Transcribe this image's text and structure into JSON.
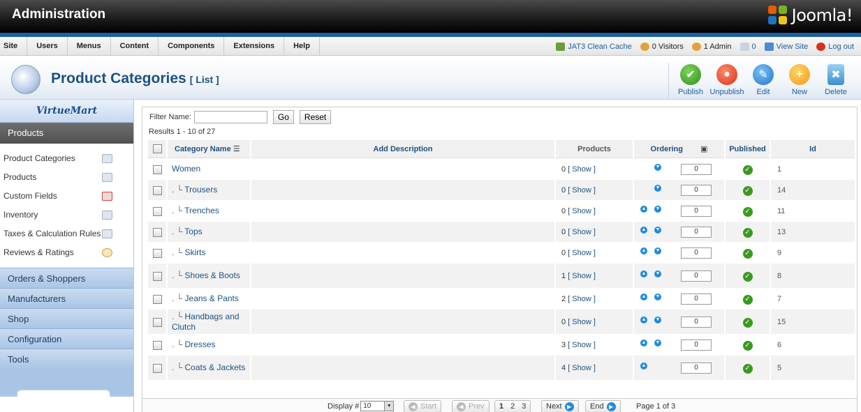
{
  "header": {
    "title": "Administration",
    "brand": "Joomla!"
  },
  "menu": {
    "items": [
      "Site",
      "Users",
      "Menus",
      "Content",
      "Components",
      "Extensions",
      "Help"
    ],
    "status": {
      "cache": "JAT3 Clean Cache",
      "visitors": "0 Visitors",
      "admins": "1 Admin",
      "messages": "0",
      "view_site": "View Site",
      "logout": "Log out"
    }
  },
  "page": {
    "title": "Product Categories",
    "subtitle": "[ List ]"
  },
  "toolbar": {
    "publish": "Publish",
    "unpublish": "Unpublish",
    "edit": "Edit",
    "new": "New",
    "delete": "Delete"
  },
  "sidebar": {
    "logo": "VirtueMart",
    "heading": "Products",
    "items": [
      "Product Categories",
      "Products",
      "Custom Fields",
      "Inventory",
      "Taxes & Calculation Rules",
      "Reviews & Ratings"
    ],
    "sections": [
      "Orders & Shoppers",
      "Manufacturers",
      "Shop",
      "Configuration",
      "Tools"
    ]
  },
  "filter": {
    "label": "Filter Name:",
    "value": "",
    "go": "Go",
    "reset": "Reset",
    "results": "Results 1 - 10 of 27"
  },
  "table": {
    "headers": {
      "name": "Category Name",
      "desc": "Add Description",
      "products": "Products",
      "ordering": "Ordering",
      "published": "Published",
      "id": "Id"
    },
    "show_label": "[ Show ]",
    "rows": [
      {
        "prefix": "",
        "name": "Women",
        "products": "0",
        "order": "0",
        "id": "1",
        "up": false,
        "down": true
      },
      {
        "prefix": ". └",
        "name": "Trousers",
        "products": "0",
        "order": "0",
        "id": "14",
        "up": false,
        "down": true
      },
      {
        "prefix": ". └",
        "name": "Trenches",
        "products": "0",
        "order": "0",
        "id": "11",
        "up": true,
        "down": true
      },
      {
        "prefix": ". └",
        "name": "Tops",
        "products": "0",
        "order": "0",
        "id": "13",
        "up": true,
        "down": true
      },
      {
        "prefix": ". └",
        "name": "Skirts",
        "products": "0",
        "order": "0",
        "id": "9",
        "up": true,
        "down": true
      },
      {
        "prefix": ". └",
        "name": "Shoes & Boots",
        "products": "1",
        "order": "0",
        "id": "8",
        "up": true,
        "down": true
      },
      {
        "prefix": ". └",
        "name": "Jeans & Pants",
        "products": "2",
        "order": "0",
        "id": "7",
        "up": true,
        "down": true
      },
      {
        "prefix": ". └",
        "name": "Handbags and Clutch",
        "products": "0",
        "order": "0",
        "id": "15",
        "up": true,
        "down": true
      },
      {
        "prefix": ". └",
        "name": "Dresses",
        "products": "3",
        "order": "0",
        "id": "6",
        "up": true,
        "down": true
      },
      {
        "prefix": ". └",
        "name": "Coats & Jackets",
        "products": "4",
        "order": "0",
        "id": "5",
        "up": true,
        "down": false
      }
    ]
  },
  "pager": {
    "display_label": "Display #",
    "display_value": "10",
    "start": "Start",
    "prev": "Prev",
    "pages": [
      "1",
      "2",
      "3"
    ],
    "next": "Next",
    "end": "End",
    "info": "Page 1 of 3"
  }
}
